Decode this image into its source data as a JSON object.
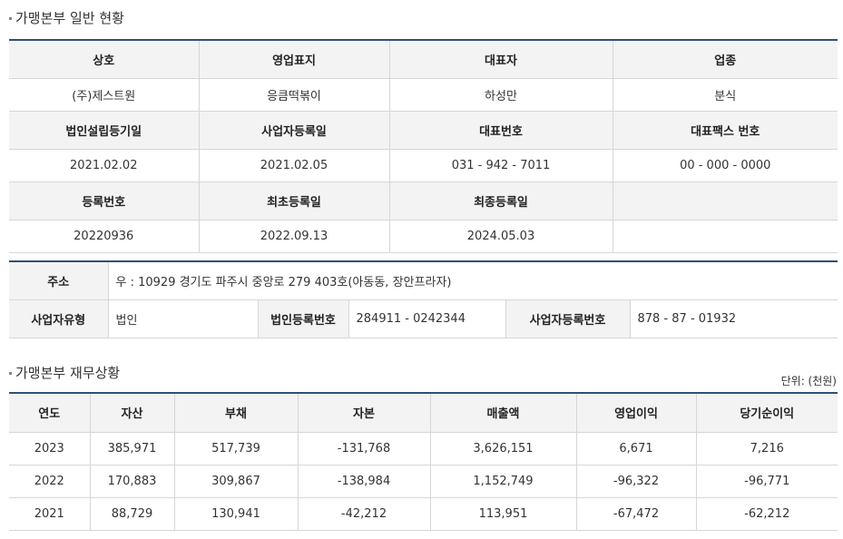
{
  "general": {
    "title": "가맹본부 일반 현황",
    "row1_headers": [
      "상호",
      "영업표지",
      "대표자",
      "업종"
    ],
    "row1_values": [
      "(주)제스트원",
      "응큼떡볶이",
      "하성만",
      "분식"
    ],
    "row2_headers": [
      "법인설립등기일",
      "사업자등록일",
      "대표번호",
      "대표팩스 번호"
    ],
    "row2_values": [
      "2021.02.02",
      "2021.02.05",
      "031 - 942 - 7011",
      "00 - 000 - 0000"
    ],
    "row3_headers": [
      "등록번호",
      "최초등록일",
      "최종등록일",
      ""
    ],
    "row3_values": [
      "20220936",
      "2022.09.13",
      "2024.05.03",
      ""
    ]
  },
  "address": {
    "label": "주소",
    "value": "우 : 10929 경기도 파주시 중앙로 279 403호(아동동, 장안프라자)",
    "biz_type_label": "사업자유형",
    "biz_type_value": "법인",
    "corp_no_label": "법인등록번호",
    "corp_no_value": "284911 - 0242344",
    "biz_no_label": "사업자등록번호",
    "biz_no_value": "878 - 87 - 01932"
  },
  "finance": {
    "title": "가맹본부 재무상황",
    "unit": "단위: (천원)",
    "headers": [
      "연도",
      "자산",
      "부채",
      "자본",
      "매출액",
      "영업이익",
      "당기순이익"
    ],
    "rows": [
      [
        "2023",
        "385,971",
        "517,739",
        "-131,768",
        "3,626,151",
        "6,671",
        "7,216"
      ],
      [
        "2022",
        "170,883",
        "309,867",
        "-138,984",
        "1,152,749",
        "-96,322",
        "-96,771"
      ],
      [
        "2021",
        "88,729",
        "130,941",
        "-42,212",
        "113,951",
        "-67,472",
        "-62,212"
      ]
    ]
  },
  "colors": {
    "table_top_border": "#2f4f75",
    "header_bg": "#f3f3f3"
  }
}
